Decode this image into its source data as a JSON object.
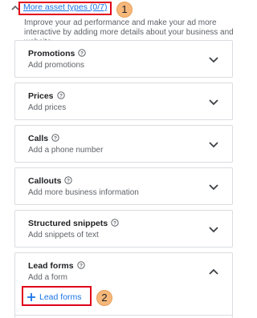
{
  "header": {
    "more_link": "More asset types (0/7)",
    "marker1": "1",
    "description": "Improve your ad performance and make your ad more interactive by adding more details about your business and website"
  },
  "cards": [
    {
      "title": "Promotions",
      "subtitle": "Add promotions",
      "expanded": false
    },
    {
      "title": "Prices",
      "subtitle": "Add prices",
      "expanded": false
    },
    {
      "title": "Calls",
      "subtitle": "Add a phone number",
      "expanded": false
    },
    {
      "title": "Callouts",
      "subtitle": "Add more business information",
      "expanded": false
    },
    {
      "title": "Structured snippets",
      "subtitle": "Add snippets of text",
      "expanded": false
    },
    {
      "title": "Lead forms",
      "subtitle": "Add a form",
      "expanded": true
    }
  ],
  "lead_forms": {
    "button_label": "Lead forms",
    "marker2": "2"
  },
  "colors": {
    "link": "#1a73e8",
    "highlight_border": "#e0001a",
    "marker_fill": "#f5b77a"
  },
  "icons": {
    "collapse": "chevron-up-icon",
    "help": "help-circle-icon",
    "expand": "chevron-down-icon",
    "add": "plus-icon"
  }
}
